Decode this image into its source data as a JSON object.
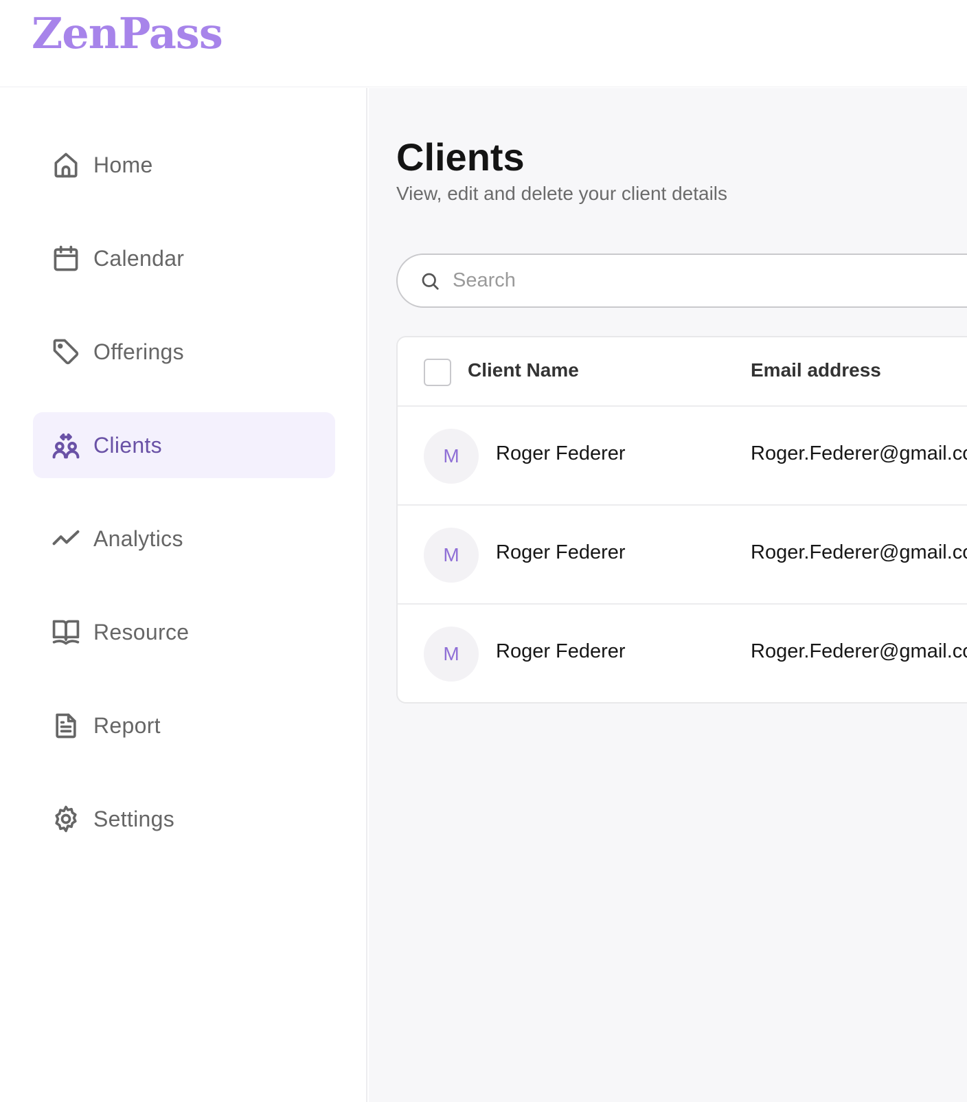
{
  "app": {
    "logo_text": "ZenPass",
    "brand_color": "#a784ea",
    "accent_color": "#6a52a6"
  },
  "sidebar": {
    "items": [
      {
        "label": "Home",
        "icon": "home-icon",
        "active": false
      },
      {
        "label": "Calendar",
        "icon": "calendar-icon",
        "active": false
      },
      {
        "label": "Offerings",
        "icon": "tag-icon",
        "active": false
      },
      {
        "label": "Clients",
        "icon": "clients-icon",
        "active": true
      },
      {
        "label": "Analytics",
        "icon": "trend-line-icon",
        "active": false
      },
      {
        "label": "Resource",
        "icon": "book-icon",
        "active": false
      },
      {
        "label": "Report",
        "icon": "document-icon",
        "active": false
      },
      {
        "label": "Settings",
        "icon": "gear-icon",
        "active": false
      }
    ]
  },
  "main": {
    "title": "Clients",
    "subtitle": "View, edit and delete your client details",
    "search": {
      "placeholder": "Search",
      "value": ""
    },
    "table": {
      "columns": [
        "Client Name",
        "Email address"
      ],
      "rows": [
        {
          "avatar_initial": "M",
          "name": "Roger Federer",
          "email": "Roger.Federer@gmail.com"
        },
        {
          "avatar_initial": "M",
          "name": "Roger Federer",
          "email": "Roger.Federer@gmail.com"
        },
        {
          "avatar_initial": "M",
          "name": "Roger Federer",
          "email": "Roger.Federer@gmail.com"
        }
      ]
    }
  }
}
